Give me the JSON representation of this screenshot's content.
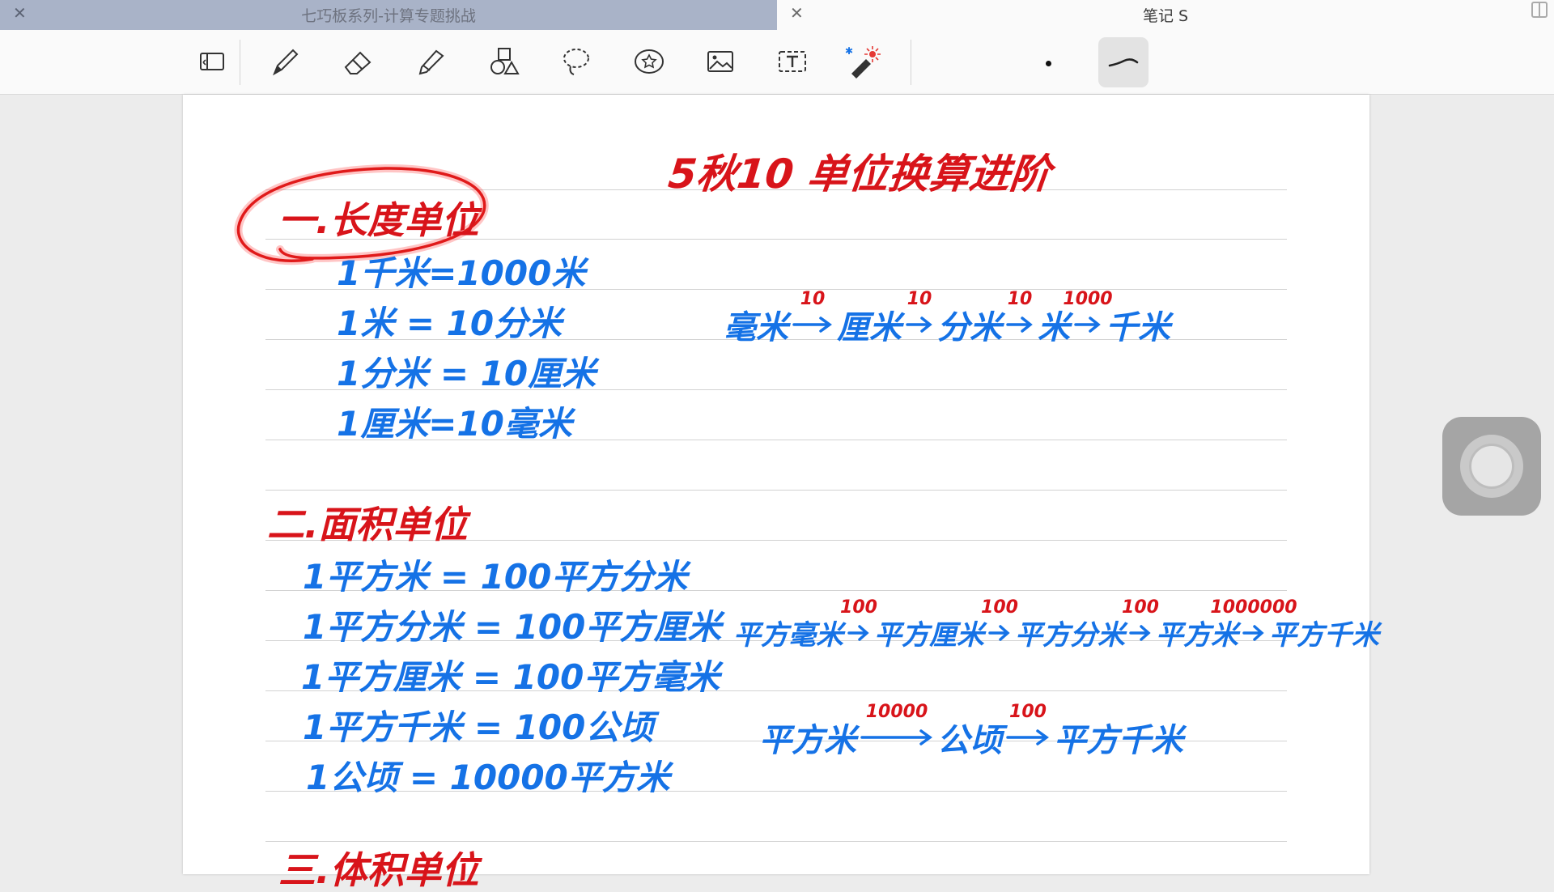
{
  "tabs": [
    {
      "title": "七巧板系列-计算专题挑战",
      "active": false
    },
    {
      "title": "笔记 S",
      "active": true
    }
  ],
  "toolbar": {
    "tools": [
      "sidebar-toggle-icon",
      "pen-icon",
      "eraser-icon",
      "highlighter-icon",
      "shapes-icon",
      "lasso-icon",
      "sticker-icon",
      "image-icon",
      "text-box-icon",
      "laser-pointer-icon"
    ],
    "bluetooth_symbol": "✱"
  },
  "colors": {
    "ink_blue": "#1572e6",
    "ink_red": "#d8141a",
    "tab_inactive": "#a9b3c8"
  },
  "note": {
    "title": "5秋10 单位换算进阶",
    "sections": [
      {
        "heading": "一.长度单位",
        "lines": [
          "1千米=1000米",
          "1米 = 10分米",
          "1分米 = 10厘米",
          "1厘米=10毫米"
        ]
      },
      {
        "heading": "二.面积单位",
        "lines": [
          "1平方米 = 100平方分米",
          "1平方分米 = 100平方厘米",
          "1平方厘米 = 100平方毫米",
          "1平方千米 = 100公顷",
          "1公顷 = 10000平方米"
        ]
      },
      {
        "heading": "三.体积单位"
      }
    ],
    "length_chain": {
      "nodes": [
        "毫米",
        "厘米",
        "分米",
        "米",
        "千米"
      ],
      "rates": [
        "10",
        "10",
        "10",
        "1000"
      ]
    },
    "area_chain_1": {
      "nodes": [
        "平方毫米",
        "平方厘米",
        "平方分米",
        "平方米",
        "平方千米"
      ],
      "rates": [
        "100",
        "100",
        "100",
        "1000000"
      ]
    },
    "area_chain_2": {
      "nodes": [
        "平方米",
        "公顷",
        "平方千米"
      ],
      "rates": [
        "10000",
        "100"
      ]
    }
  }
}
